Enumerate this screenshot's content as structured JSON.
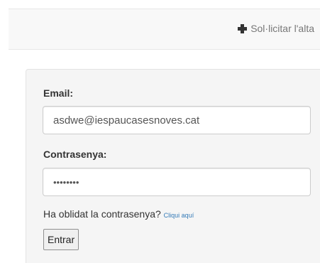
{
  "header": {
    "signup_label": "Sol·licitar l'alta",
    "signup_icon": "plus-icon"
  },
  "login": {
    "email_label": "Email:",
    "email_value": "asdwe@iespaucasesnoves.cat",
    "password_label": "Contrasenya:",
    "password_masked": "••••••••",
    "forgot_text": "Ha oblidat la contrasenya?",
    "forgot_link": "Cliqui aquí",
    "submit_label": "Entrar"
  },
  "colors": {
    "link": "#337ab7",
    "panel_bg": "#f5f5f5",
    "topbar_bg": "#f8f8f8"
  }
}
